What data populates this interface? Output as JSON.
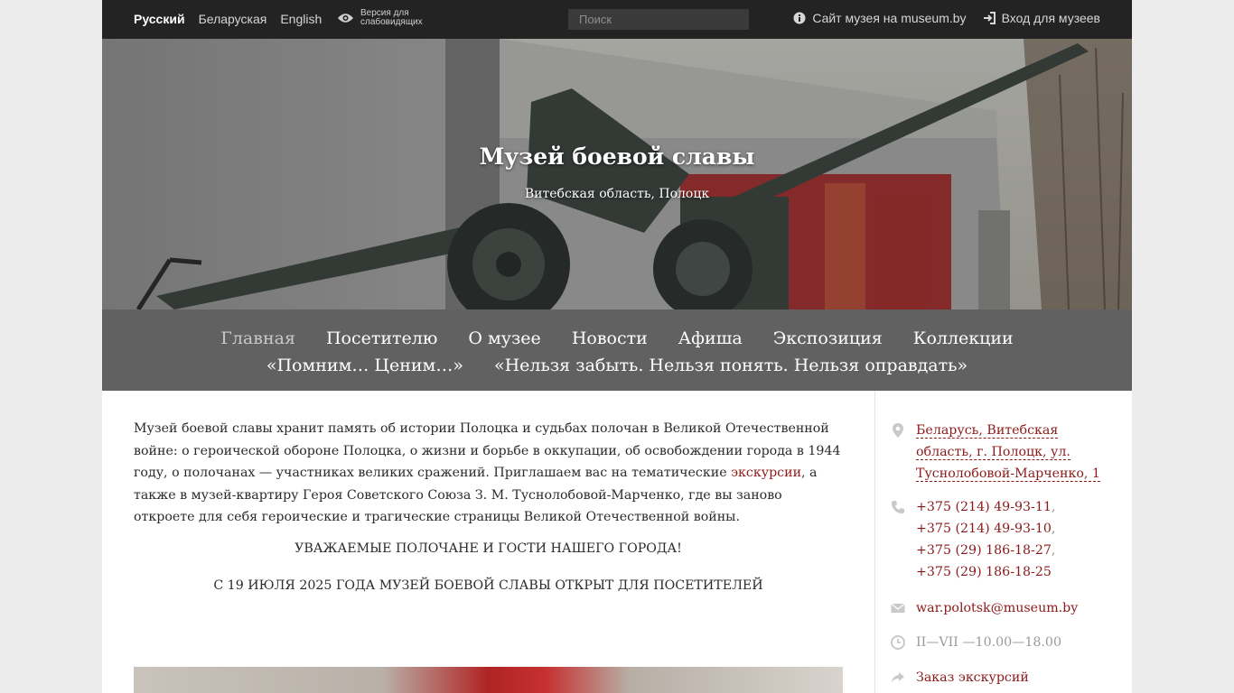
{
  "topbar": {
    "languages": [
      {
        "label": "Русский",
        "active": true
      },
      {
        "label": "Беларуская",
        "active": false
      },
      {
        "label": "English",
        "active": false
      }
    ],
    "low_vision": "Версия для слабовидящих",
    "search_placeholder": "Поиск",
    "museum_site": "Сайт музея на museum.by",
    "login": "Вход для музеев"
  },
  "hero": {
    "title": "Музей боевой славы",
    "subtitle": "Витебская область, Полоцк"
  },
  "nav": {
    "items": [
      "Главная",
      "Посетителю",
      "О музее",
      "Новости",
      "Афиша",
      "Экспозиция",
      "Коллекции",
      "«Помним… Ценим…»",
      "«Нельзя забыть. Нельзя понять. Нельзя оправдать»"
    ],
    "active_index": 0
  },
  "main": {
    "intro_before": "Музей боевой славы хранит память об истории Полоцка и судьбах полочан в Великой Отечественной войне: о героической обороне Полоцка, о жизни и борьбе в оккупации, об освобождении города в 1944 году, о полочанах — участниках великих сражений. Приглашаем вас на тематические ",
    "intro_link": "экскурсии",
    "intro_after": ", а также в музей-квартиру Героя Советского Союза З. М. Туснолобовой-Марченко, где вы заново откроете для себя героические и трагические страницы Великой Отечественной войны.",
    "notice1": "УВАЖАЕМЫЕ ПОЛОЧАНЕ И ГОСТИ НАШЕГО ГОРОДА!",
    "notice2": "С 19 ИЮЛЯ 2025 ГОДА МУЗЕЙ БОЕВОЙ СЛАВЫ ОТКРЫТ ДЛЯ ПОСЕТИТЕЛЕЙ"
  },
  "sidebar": {
    "address": "Беларусь, Витебская область, г. Полоцк, ул. Туснолобовой-Марченко, 1",
    "phones": [
      "+375 (214) 49-93-11",
      "+375 (214) 49-93-10",
      "+375 (29) 186-18-27",
      "+375 (29) 186-18-25"
    ],
    "email": "war.polotsk@museum.by",
    "hours": "II—VII —10.00—18.00",
    "tour_order": "Заказ экскурсий"
  },
  "colors": {
    "accent": "#8b1a1a",
    "topbar": "#232323",
    "nav": "#616161"
  },
  "icons": [
    "eye-icon",
    "info-icon",
    "login-icon",
    "map-pin-icon",
    "phone-icon",
    "envelope-icon",
    "clock-icon",
    "share-arrow-icon"
  ]
}
